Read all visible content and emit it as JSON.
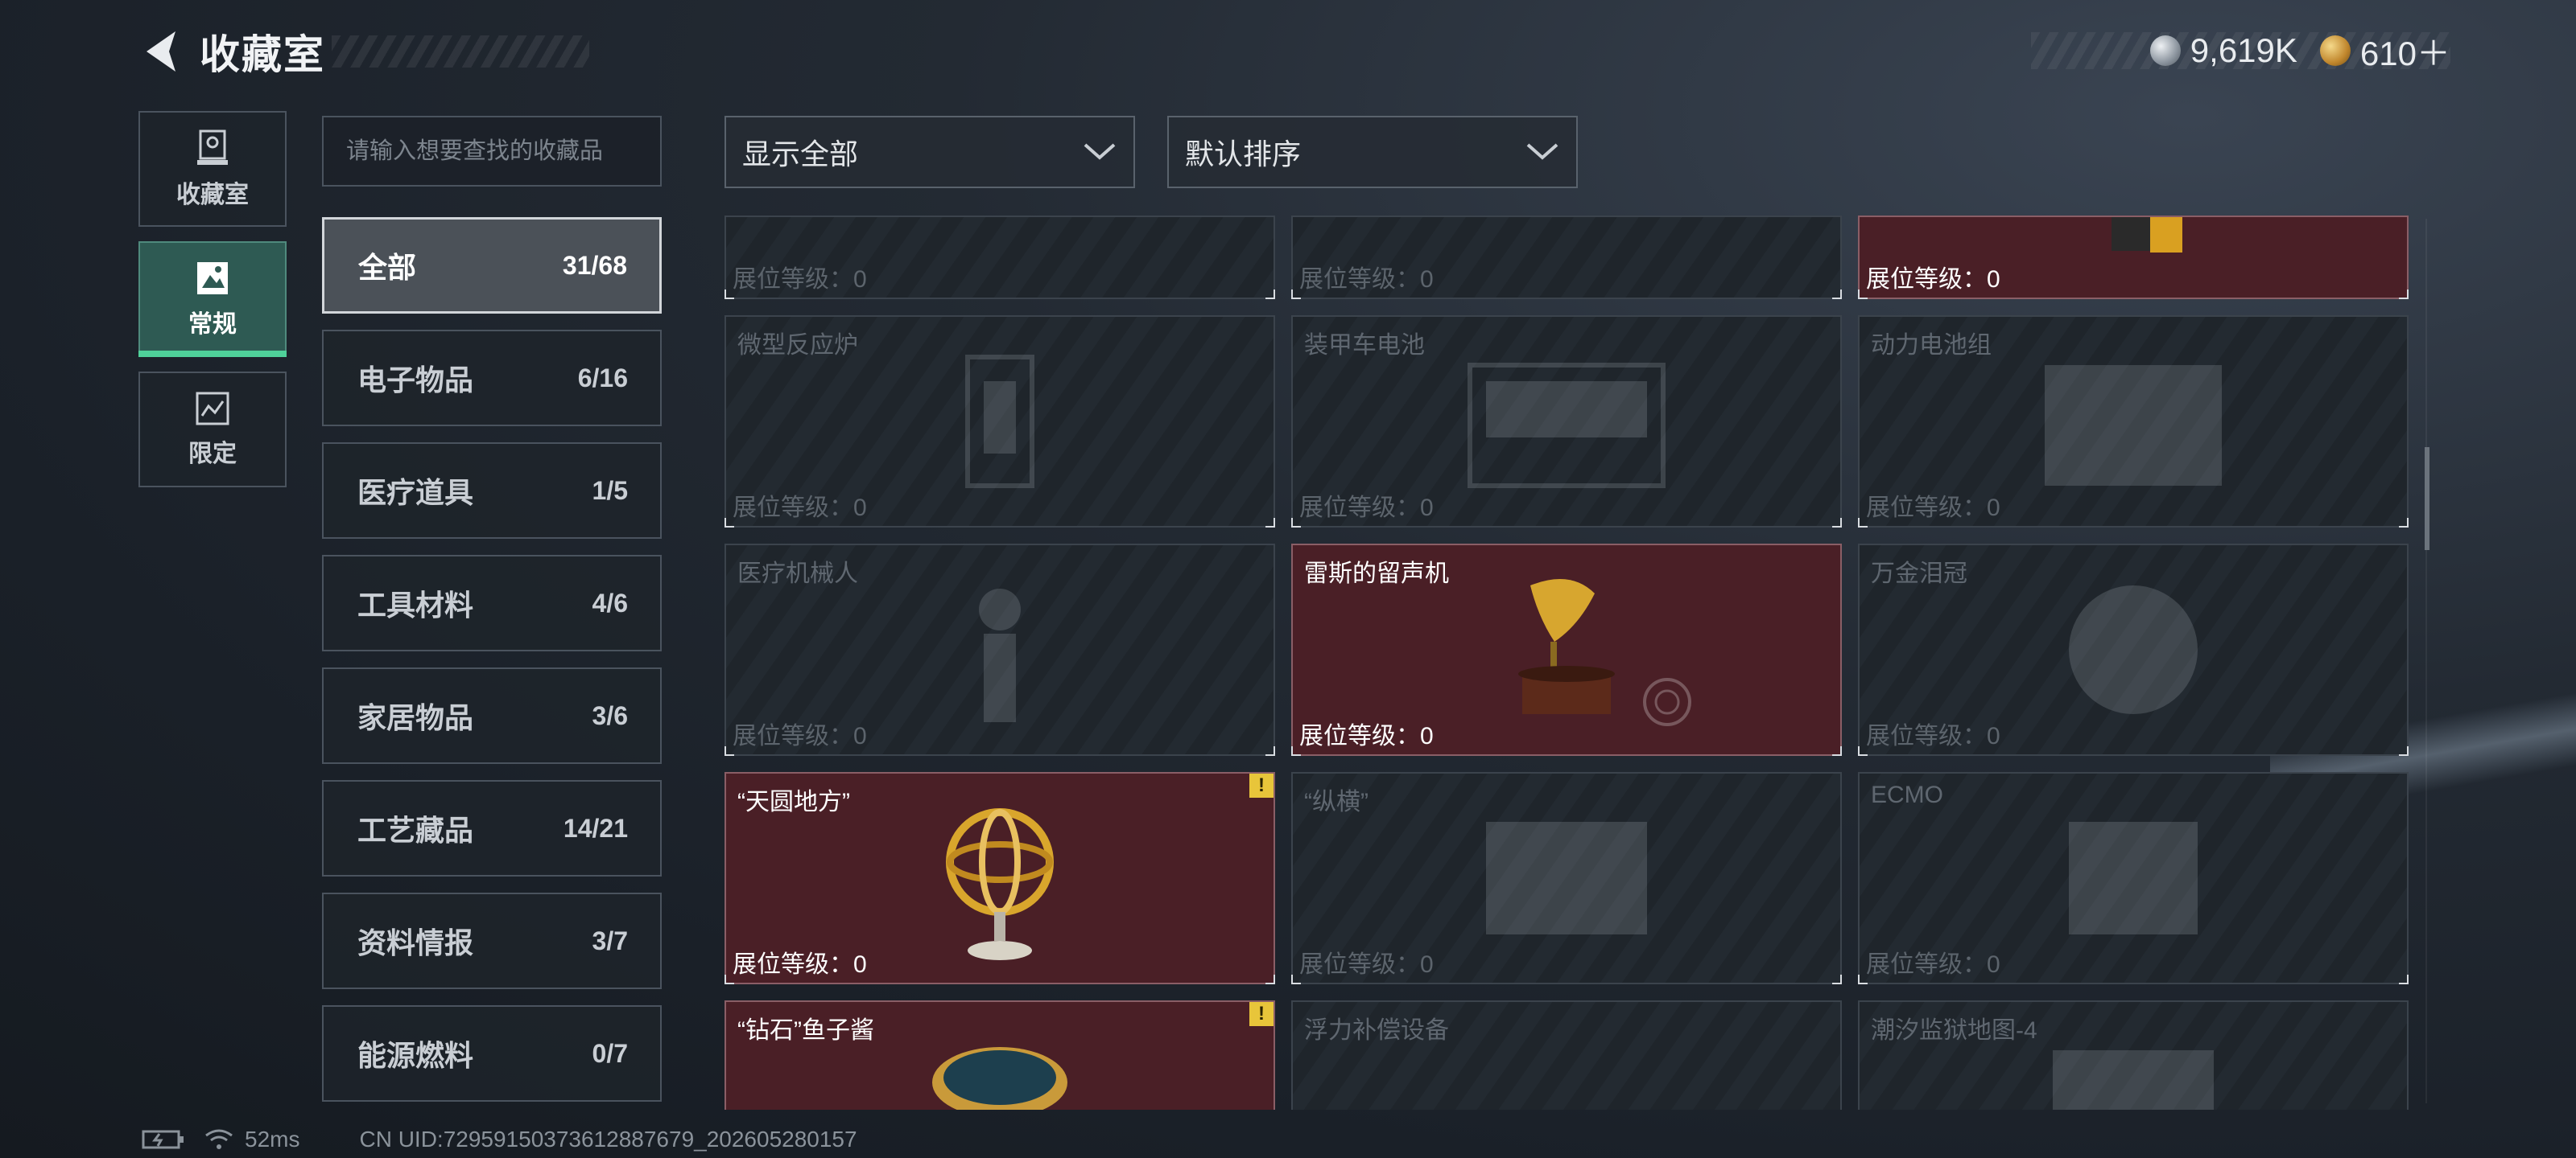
{
  "header": {
    "title": "收藏室"
  },
  "currency": [
    {
      "icon": "silver-coin-icon",
      "value": "9,619K"
    },
    {
      "icon": "gold-coin-icon",
      "value": "610＋"
    }
  ],
  "leftnav": [
    {
      "label": "收藏室",
      "icon": "trophy-room-icon",
      "active": false
    },
    {
      "label": "常规",
      "icon": "regular-collection-icon",
      "active": true
    },
    {
      "label": "限定",
      "icon": "limited-collection-icon",
      "active": false
    }
  ],
  "search": {
    "placeholder": "请输入想要查找的收藏品"
  },
  "categories": [
    {
      "name": "全部",
      "count": "31/68",
      "active": true
    },
    {
      "name": "电子物品",
      "count": "6/16"
    },
    {
      "name": "医疗道具",
      "count": "1/5"
    },
    {
      "name": "工具材料",
      "count": "4/6"
    },
    {
      "name": "家居物品",
      "count": "3/6"
    },
    {
      "name": "工艺藏品",
      "count": "14/21"
    },
    {
      "name": "资料情报",
      "count": "3/7"
    },
    {
      "name": "能源燃料",
      "count": "0/7"
    }
  ],
  "filters": {
    "display": "显示全部",
    "sort": "默认排序"
  },
  "level_prefix": "展位等级：0",
  "cards": [
    {
      "name": "",
      "owned": false,
      "level": "展位等级：0"
    },
    {
      "name": "",
      "owned": false,
      "level": "展位等级：0"
    },
    {
      "name": "",
      "owned": true,
      "level": "展位等级：0"
    },
    {
      "name": "微型反应炉",
      "owned": false,
      "level": "展位等级：0"
    },
    {
      "name": "装甲车电池",
      "owned": false,
      "level": "展位等级：0"
    },
    {
      "name": "动力电池组",
      "owned": false,
      "level": "展位等级：0"
    },
    {
      "name": "医疗机械人",
      "owned": false,
      "level": "展位等级：0"
    },
    {
      "name": "雷斯的留声机",
      "owned": true,
      "level": "展位等级：0"
    },
    {
      "name": "万金泪冠",
      "owned": false,
      "level": "展位等级：0"
    },
    {
      "name": "“天圆地方”",
      "owned": true,
      "level": "展位等级：0",
      "warn": "!"
    },
    {
      "name": "“纵横”",
      "owned": false,
      "level": "展位等级：0"
    },
    {
      "name": "ECMO",
      "owned": false,
      "level": "展位等级：0"
    },
    {
      "name": "“钻石”鱼子酱",
      "owned": true,
      "warn": "!"
    },
    {
      "name": "浮力补偿设备",
      "owned": false
    },
    {
      "name": "潮汐监狱地图-4",
      "owned": false
    }
  ],
  "footer": {
    "ping": "52ms",
    "uid": "CN UID:72959150373612887679_202605280157"
  },
  "colors": {
    "owned_card": "#4a1f26",
    "active_tab": "#2e5a53",
    "accent_green": "#4fd19a",
    "warn": "#e8c53a"
  }
}
